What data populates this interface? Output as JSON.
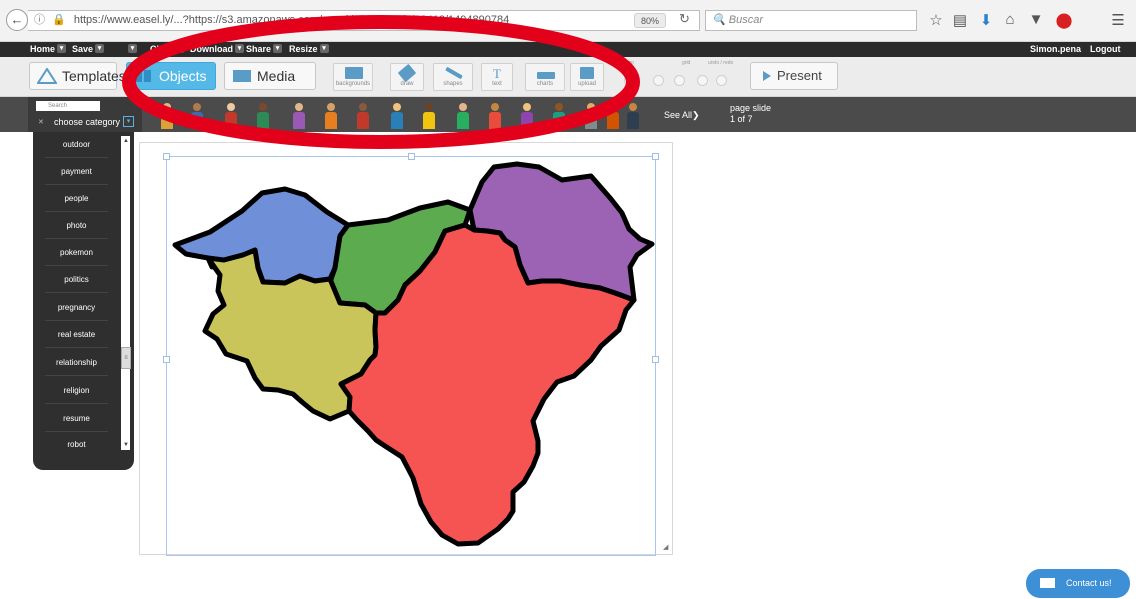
{
  "browser": {
    "url": "https://www.easel.ly/...?https://s3.amazonaws.com/easel.ly/all_easels/93413/1494890784",
    "zoom": "80%",
    "search_placeholder": "Buscar"
  },
  "menubar": {
    "items": [
      "Home",
      "Save",
      "...",
      "Clear",
      "Download",
      "Share",
      "Resize"
    ],
    "user": "Simon.pena",
    "logout": "Logout"
  },
  "toolbar": {
    "templates": "Templates",
    "objects": "Objects",
    "media": "Media",
    "tools": [
      "backgrounds",
      "draw",
      "shapes",
      "text",
      "charts",
      "upload"
    ],
    "present": "Present",
    "group_labels": [
      "snap",
      "grid",
      "undo / redo"
    ]
  },
  "object_strip": {
    "search_placeholder": "Search",
    "category": "choose category",
    "see_all": "See All",
    "page_label": "page slide",
    "page_count": "1 of 7"
  },
  "categories": [
    "outdoor",
    "payment",
    "people",
    "photo",
    "pokemon",
    "politics",
    "pregnancy",
    "real estate",
    "relationship",
    "religion",
    "resume",
    "robot"
  ],
  "contact": "Contact us!",
  "colors": {
    "objects_active": "#55b9e8",
    "annotation": "#e3001b",
    "region_blue": "#6f8fd8",
    "region_green": "#5cab4f",
    "region_purple": "#9c62b3",
    "region_yellow": "#c9c55a",
    "region_red": "#f55453"
  }
}
